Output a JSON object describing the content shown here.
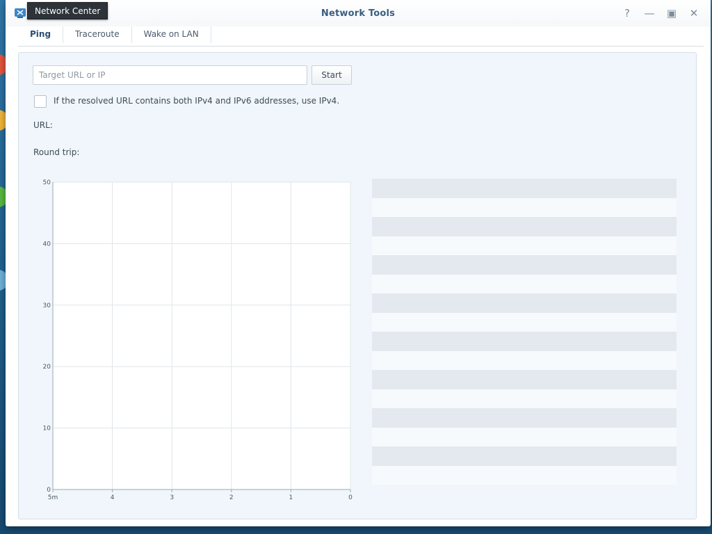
{
  "window": {
    "title": "Network Tools",
    "controls": [
      "help",
      "minimize",
      "maximize",
      "close"
    ]
  },
  "tooltip": {
    "text": "Network Center"
  },
  "tabs": [
    {
      "label": "Ping",
      "active": true
    },
    {
      "label": "Traceroute",
      "active": false
    },
    {
      "label": "Wake on LAN",
      "active": false
    }
  ],
  "ping": {
    "target_placeholder": "Target URL or IP",
    "target_value": "",
    "start_label": "Start",
    "ipv4_option": {
      "label": "If the resolved URL contains both IPv4 and IPv6 addresses, use IPv4.",
      "checked": false
    },
    "url_label": "URL:",
    "round_trip_label": "Round trip:"
  },
  "chart_data": {
    "type": "line",
    "title": "",
    "xlabel": "",
    "ylabel": "",
    "x_ticks": [
      "5m",
      "4",
      "3",
      "2",
      "1",
      "0"
    ],
    "y_ticks": [
      0,
      10,
      20,
      30,
      40,
      50
    ],
    "ylim": [
      0,
      50
    ],
    "grid": true,
    "series": []
  },
  "results": {
    "row_count": 16,
    "rows": []
  },
  "colors": {
    "accent": "#3a5d80",
    "panel_bg": "#f0f6fb",
    "stripe": "#e3e9ef",
    "grid": "#dfe5ea"
  }
}
